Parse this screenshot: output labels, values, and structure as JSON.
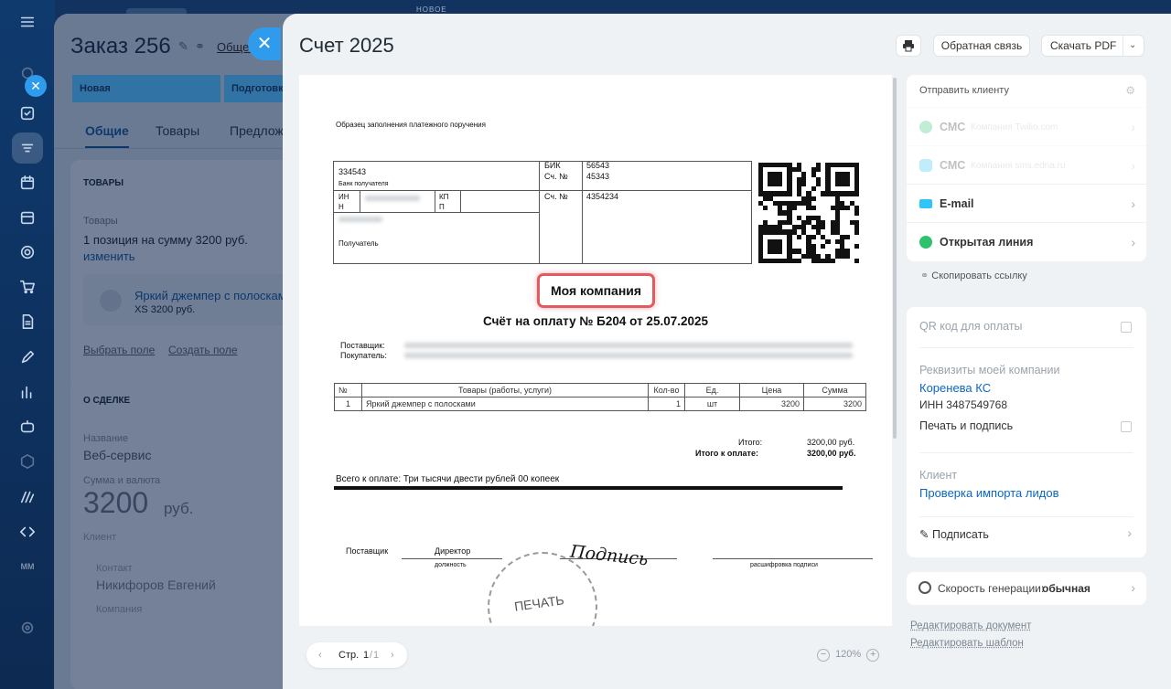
{
  "background": {
    "top_label": "НОВОЕ",
    "deal": {
      "title": "Заказ 256",
      "general_link": "Общее",
      "stages": [
        "Новая",
        "Подготовка"
      ],
      "tabs": [
        "Общие",
        "Товары",
        "Предложения"
      ],
      "goods_section": "ТОВАРЫ",
      "goods_label": "Товары",
      "goods_summary": "1 позиция на сумму 3200 руб.",
      "goods_edit": "изменить",
      "product_name": "Яркий джемпер с полосками",
      "product_meta": "XS   3200 руб.",
      "select_field": "Выбрать поле",
      "create_field": "Создать поле",
      "about_section": "О СДЕЛКЕ",
      "name_label": "Название",
      "name_value": "Веб-сервис",
      "amount_label": "Сумма и валюта",
      "amount_value": "3200",
      "amount_currency": "руб.",
      "client_label": "Клиент",
      "contact_label": "Контакт",
      "contact_value": "Никифоров Евгений",
      "company_label": "Компания"
    }
  },
  "slider": {
    "title": "Счет 2025",
    "feedback_button": "Обратная связь",
    "download_button": "Скачать PDF",
    "pager": {
      "prefix": "Стр.",
      "current": "1",
      "total": "1"
    },
    "zoom": "120%"
  },
  "document": {
    "sample_caption": "Образец заполнения платежного поручения",
    "bank_number": "334543",
    "bank_label": "Банк получателя",
    "bik_label": "БИК",
    "bik_value": "56543",
    "corr_label": "Сч. №",
    "corr_value": "45343",
    "inn_label": "ИН Н",
    "kpp_label": "КП П",
    "acc_label": "Сч. №",
    "acc_value": "4354234",
    "recipient_label": "Получатель",
    "company_name": "Моя компания",
    "invoice_title": "Счёт на оплату № Б204 от 25.07.2025",
    "supplier_label": "Поставщик:",
    "buyer_label": "Покупатель:",
    "table_headers": [
      "№",
      "Товары (работы, услуги)",
      "Кол-во",
      "Ед.",
      "Цена",
      "Сумма"
    ],
    "table_rows": [
      [
        "1",
        "Яркий джемпер с полосками",
        "1",
        "шт",
        "3200",
        "3200"
      ]
    ],
    "total_label": "Итого:",
    "total_value": "3200,00 руб.",
    "total_pay_label": "Итого к оплате:",
    "total_pay_value": "3200,00 руб.",
    "total_words": "Всего к оплате: Три тысячи двести рублей 00 копеек",
    "sign_supplier": "Поставщик",
    "sign_position": "Директор",
    "sign_position_caption": "должность",
    "signature": "Подпись",
    "sign_decode_caption": "расшифровка подписи",
    "stamp": "ПЕЧАТЬ"
  },
  "panel": {
    "send_title": "Отправить клиенту",
    "channels": [
      {
        "label": "СМС",
        "sub": "Компания Twilio.com",
        "color": "#2fc26e"
      },
      {
        "label": "СМС",
        "sub": "Компания sms.edna.ru",
        "color": "#2fc6f6"
      },
      {
        "label": "E-mail",
        "sub": "",
        "color": "#2fc6f6"
      },
      {
        "label": "Открытая линия",
        "sub": "",
        "color": "#2fc26e"
      }
    ],
    "copy_link": "Скопировать ссылку",
    "qr_label": "QR код для оплаты",
    "requisites_label": "Реквизиты моей компании",
    "requisites_company": "Коренева КС",
    "requisites_inn": "ИНН 3487549768",
    "print_sign_label": "Печать и подпись",
    "client_label": "Клиент",
    "client_value": "Проверка импорта лидов",
    "sign_button": "Подписать",
    "speed_label": "Скорость генерации:",
    "speed_value": "обычная",
    "edit_document": "Редактировать документ",
    "edit_template": "Редактировать шаблон"
  }
}
